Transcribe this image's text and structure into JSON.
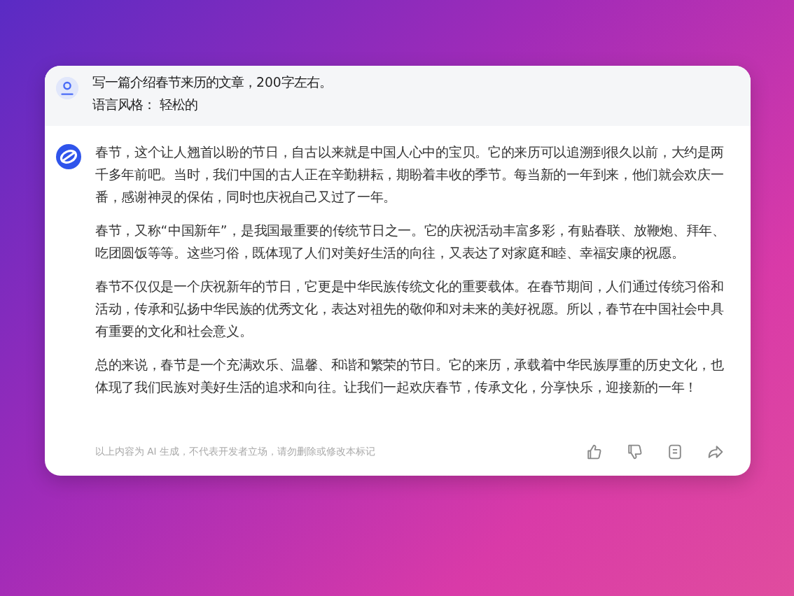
{
  "prompt": {
    "lines": [
      "写一篇介绍春节来历的文章，200字左右。",
      "语言风格： 轻松的"
    ]
  },
  "answer": {
    "paragraphs": [
      "春节，这个让人翘首以盼的节日，自古以来就是中国人心中的宝贝。它的来历可以追溯到很久以前，大约是两千多年前吧。当时，我们中国的古人正在辛勤耕耘，期盼着丰收的季节。每当新的一年到来，他们就会欢庆一番，感谢神灵的保佑，同时也庆祝自己又过了一年。",
      "春节，又称“中国新年”，是我国最重要的传统节日之一。它的庆祝活动丰富多彩，有贴春联、放鞭炮、拜年、吃团圆饭等等。这些习俗，既体现了人们对美好生活的向往，又表达了对家庭和睦、幸福安康的祝愿。",
      "春节不仅仅是一个庆祝新年的节日，它更是中华民族传统文化的重要载体。在春节期间，人们通过传统习俗和活动，传承和弘扬中华民族的优秀文化，表达对祖先的敬仰和对未来的美好祝愿。所以，春节在中国社会中具有重要的文化和社会意义。",
      "总的来说，春节是一个充满欢乐、温馨、和谐和繁荣的节日。它的来历，承载着中华民族厚重的历史文化，也体现了我们民族对美好生活的追求和向往。让我们一起欢庆春节，传承文化，分享快乐，迎接新的一年！"
    ],
    "disclaimer": "以上内容为 AI 生成，不代表开发者立场，请勿删除或修改本标记",
    "actions": [
      {
        "kind": "like"
      },
      {
        "kind": "dislike"
      },
      {
        "kind": "copy"
      },
      {
        "kind": "share"
      }
    ]
  }
}
